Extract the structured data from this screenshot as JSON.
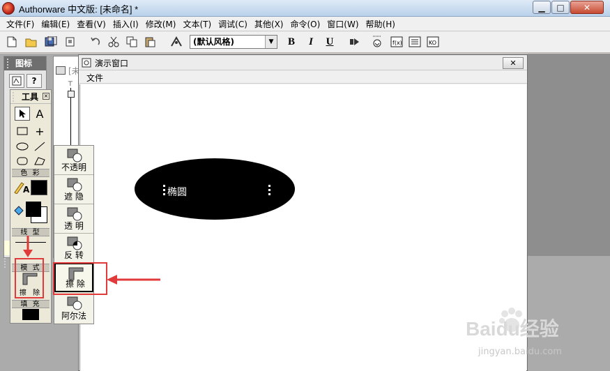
{
  "app": {
    "title": "Authorware 中文版: [未命名] *"
  },
  "window_controls": {
    "minimize": "▁",
    "maximize": "□",
    "close": "✕"
  },
  "menubar": {
    "items": [
      {
        "label": "文件(F)"
      },
      {
        "label": "编辑(E)"
      },
      {
        "label": "查看(V)"
      },
      {
        "label": "插入(I)"
      },
      {
        "label": "修改(M)"
      },
      {
        "label": "文本(T)"
      },
      {
        "label": "调试(C)"
      },
      {
        "label": "其他(X)"
      },
      {
        "label": "命令(O)"
      },
      {
        "label": "窗口(W)"
      },
      {
        "label": "帮助(H)"
      }
    ]
  },
  "toolbar": {
    "style_select": "(默认风格)",
    "bold": "B",
    "italic": "I",
    "underline": "U"
  },
  "icons_palette": {
    "title": "图标"
  },
  "flow_window": {
    "title_fragment": "[未"
  },
  "tools_panel": {
    "title": "工具",
    "sections": {
      "color": "色 彩",
      "line": "线 型",
      "mode": "模 式",
      "mode_value": "擦 除",
      "fill": "填 充"
    }
  },
  "mode_list": {
    "options": [
      {
        "label": "不透明"
      },
      {
        "label": "遮  隐"
      },
      {
        "label": "透  明"
      },
      {
        "label": "反  转"
      },
      {
        "label": "擦  除"
      },
      {
        "label": "阿尔法"
      }
    ],
    "selected": "擦  除"
  },
  "presentation": {
    "title": "演示窗口",
    "menu_file": "文件",
    "ellipse_label": "椭圆"
  },
  "watermark": {
    "brand": "Baidu经验",
    "url": "jingyan.baidu.com"
  },
  "colors": {
    "annotation_red": "#e03a3a",
    "ellipse_fill": "#000000"
  }
}
